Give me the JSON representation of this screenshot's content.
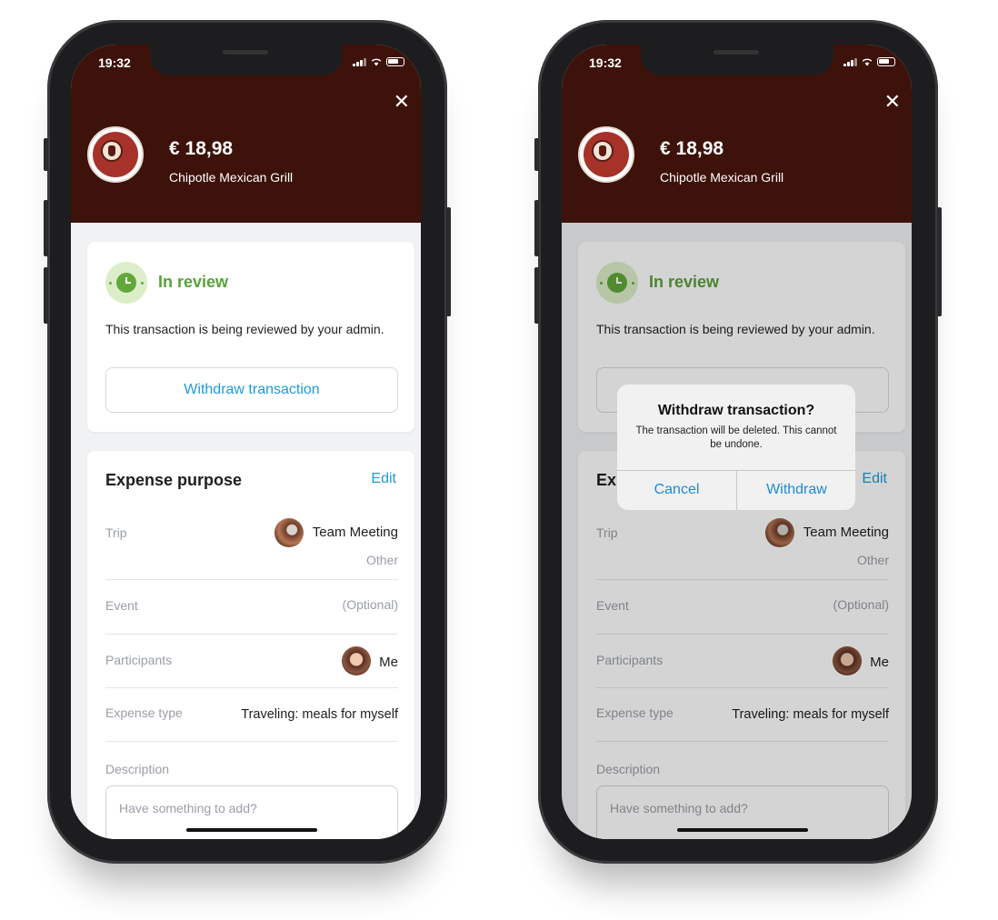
{
  "status_bar": {
    "time": "19:32"
  },
  "transaction": {
    "amount": "€ 18,98",
    "merchant": "Chipotle Mexican Grill"
  },
  "review": {
    "title": "In review",
    "text": "This transaction is being reviewed by your admin.",
    "withdraw_label": "Withdraw transaction"
  },
  "expense": {
    "title": "Expense purpose",
    "title_truncated": "Exp",
    "edit_label": "Edit",
    "trip": {
      "label": "Trip",
      "value": "Team Meeting",
      "sub": "Other"
    },
    "event": {
      "label": "Event",
      "value": "(Optional)"
    },
    "participants": {
      "label": "Participants",
      "value": "Me"
    },
    "expense_type": {
      "label": "Expense type",
      "value": "Traveling: meals for myself"
    },
    "description": {
      "label": "Description",
      "placeholder": "Have something to add?"
    }
  },
  "dialog": {
    "title": "Withdraw transaction?",
    "message": "The transaction will be deleted. This cannot be undone.",
    "cancel_label": "Cancel",
    "confirm_label": "Withdraw"
  },
  "colors": {
    "header_bg": "#3d120a",
    "accent_blue": "#1d9bd7",
    "review_green": "#58a23a"
  }
}
